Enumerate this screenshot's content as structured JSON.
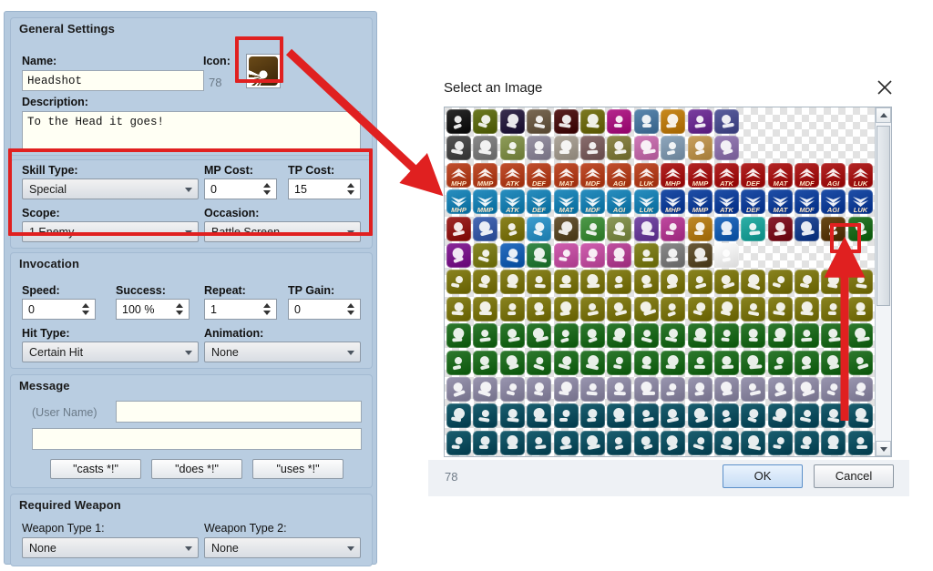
{
  "editor": {
    "general": {
      "title": "General Settings",
      "name_label": "Name:",
      "name_value": "Headshot",
      "icon_label": "Icon:",
      "icon_index": "78",
      "description_label": "Description:",
      "description_value": "To the Head it goes!"
    },
    "skill": {
      "skill_type_label": "Skill Type:",
      "skill_type_value": "Special",
      "mp_cost_label": "MP Cost:",
      "mp_cost_value": "0",
      "tp_cost_label": "TP Cost:",
      "tp_cost_value": "15",
      "scope_label": "Scope:",
      "scope_value": "1 Enemy",
      "occasion_label": "Occasion:",
      "occasion_value": "Battle Screen"
    },
    "invocation": {
      "title": "Invocation",
      "speed_label": "Speed:",
      "speed_value": "0",
      "success_label": "Success:",
      "success_value": "100 %",
      "repeat_label": "Repeat:",
      "repeat_value": "1",
      "tp_gain_label": "TP Gain:",
      "tp_gain_value": "0",
      "hit_type_label": "Hit Type:",
      "hit_type_value": "Certain Hit",
      "animation_label": "Animation:",
      "animation_value": "None"
    },
    "message": {
      "title": "Message",
      "user_name_label": "(User Name)",
      "line1_value": "",
      "line2_value": "",
      "preset_casts": "\"casts *!\"",
      "preset_does": "\"does *!\"",
      "preset_uses": "\"uses *!\""
    },
    "required_weapon": {
      "title": "Required Weapon",
      "weapon1_label": "Weapon Type 1:",
      "weapon1_value": "None",
      "weapon2_label": "Weapon Type 2:",
      "weapon2_value": "None"
    }
  },
  "dialog": {
    "title": "Select an Image",
    "close_icon": "close-icon",
    "status_index": "78",
    "ok_label": "OK",
    "cancel_label": "Cancel",
    "selected_icon_index": 78,
    "grid": {
      "columns": 16,
      "rows": 13,
      "row_themes": [
        {
          "row": 0,
          "filled": 11,
          "colors": [
            "#2b2b2b",
            "#6d7a24",
            "#3a3050",
            "#7a6a55",
            "#5a2020",
            "#7d7a22",
            "#b6288e",
            "#5b87ae",
            "#c98a1e",
            "#7b3fa0",
            "#5b5f9e"
          ]
        },
        {
          "row": 1,
          "filled": 11,
          "colors": [
            "#565656",
            "#8a8a8a",
            "#8f9d5a",
            "#9a95a6",
            "#b0a89c",
            "#8a6e6e",
            "#8f8a4e",
            "#d07bb8",
            "#8fa7bd",
            "#c9a15e",
            "#9a80b8"
          ]
        },
        {
          "row": 2,
          "filled": 16,
          "colors": [
            "#c1502f",
            "#c1502f",
            "#c1502f",
            "#c1502f",
            "#c1502f",
            "#c1502f",
            "#c1502f",
            "#c1502f",
            "#b32626",
            "#b32626",
            "#b32626",
            "#b32626",
            "#b32626",
            "#b32626",
            "#b32626",
            "#b32626"
          ]
        },
        {
          "row": 3,
          "filled": 16,
          "colors": [
            "#2a8fc0",
            "#2a8fc0",
            "#2a8fc0",
            "#2a8fc0",
            "#2a8fc0",
            "#2a8fc0",
            "#2a8fc0",
            "#2a8fc0",
            "#2050a8",
            "#2050a8",
            "#2050a8",
            "#2050a8",
            "#2050a8",
            "#2050a8",
            "#2050a8",
            "#2050a8"
          ]
        },
        {
          "row": 4,
          "filled": 16,
          "colors": [
            "#a02a28",
            "#4a6bb5",
            "#8c8420",
            "#3f9fd0",
            "#6b5a3a",
            "#4f9a4a",
            "#8d9a5a",
            "#7a4fa8",
            "#c04aa0",
            "#c08a2a",
            "#2a6fc0",
            "#2fb0a8",
            "#8a2030",
            "#2a4f9a",
            "#6a4a18",
            "#2e7a2e"
          ]
        },
        {
          "row": 5,
          "filled": 11,
          "colors": [
            "#8a2a9a",
            "#8a8a2a",
            "#2a6fc0",
            "#3a8a4a",
            "#d060b0",
            "#d060b0",
            "#c050a0",
            "#8a8a2a",
            "#8a8a8a",
            "#6a5a3a",
            "#ffffff"
          ]
        },
        {
          "row": 6,
          "filled": 16,
          "colors": [
            "#8a8420",
            "#8a8420",
            "#8a8420",
            "#8a8420",
            "#8a8420",
            "#8a8420",
            "#8a8420",
            "#8a8420",
            "#8a8420",
            "#8a8420",
            "#8a8420",
            "#8a8420",
            "#8a8420",
            "#8a8420",
            "#8a8420",
            "#8a8420"
          ]
        },
        {
          "row": 7,
          "filled": 16,
          "colors": [
            "#8a8420",
            "#8a8420",
            "#8a8420",
            "#8a8420",
            "#8a8420",
            "#8a8420",
            "#8a8420",
            "#8a8420",
            "#8a8420",
            "#8a8420",
            "#8a8420",
            "#8a8420",
            "#8a8420",
            "#8a8420",
            "#8a8420",
            "#8a8420"
          ]
        },
        {
          "row": 8,
          "filled": 16,
          "colors": [
            "#2f7a2f",
            "#2f7a2f",
            "#2f7a2f",
            "#2f7a2f",
            "#2f7a2f",
            "#2f7a2f",
            "#2f7a2f",
            "#2f7a2f",
            "#2f7a2f",
            "#2f7a2f",
            "#2f7a2f",
            "#2f7a2f",
            "#2f7a2f",
            "#2f7a2f",
            "#2f7a2f",
            "#2f7a2f"
          ]
        },
        {
          "row": 9,
          "filled": 16,
          "colors": [
            "#2f7a2f",
            "#2f7a2f",
            "#2f7a2f",
            "#2f7a2f",
            "#2f7a2f",
            "#2f7a2f",
            "#2f7a2f",
            "#2f7a2f",
            "#2f7a2f",
            "#2f7a2f",
            "#2f7a2f",
            "#2f7a2f",
            "#2f7a2f",
            "#2f7a2f",
            "#2f7a2f",
            "#2f7a2f"
          ]
        },
        {
          "row": 10,
          "filled": 16,
          "colors": [
            "#9a96b0",
            "#9a96b0",
            "#9a96b0",
            "#9a96b0",
            "#9a96b0",
            "#9a96b0",
            "#9a96b0",
            "#9a96b0",
            "#9a96b0",
            "#9a96b0",
            "#9a96b0",
            "#9a96b0",
            "#9a96b0",
            "#9a96b0",
            "#9a96b0",
            "#9a96b0"
          ]
        },
        {
          "row": 11,
          "filled": 16,
          "colors": [
            "#1b5f70",
            "#1b5f70",
            "#1b5f70",
            "#1b5f70",
            "#1b5f70",
            "#1b5f70",
            "#1b5f70",
            "#1b5f70",
            "#1b5f70",
            "#1b5f70",
            "#1b5f70",
            "#1b5f70",
            "#1b5f70",
            "#1b5f70",
            "#1b5f70",
            "#1b5f70"
          ]
        },
        {
          "row": 12,
          "filled": 16,
          "colors": [
            "#1b5f70",
            "#1b5f70",
            "#1b5f70",
            "#1b5f70",
            "#1b5f70",
            "#1b5f70",
            "#1b5f70",
            "#1b5f70",
            "#1b5f70",
            "#1b5f70",
            "#1b5f70",
            "#1b5f70",
            "#1b5f70",
            "#1b5f70",
            "#1b5f70",
            "#1b5f70"
          ]
        }
      ],
      "stat_labels_row2": [
        "MHP",
        "MMP",
        "ATK",
        "DEF",
        "MAT",
        "MDF",
        "AGI",
        "LUK",
        "MHP",
        "MMP",
        "ATK",
        "DEF",
        "MAT",
        "MDF",
        "AGI",
        "LUK"
      ],
      "stat_labels_row3": [
        "MHP",
        "MMP",
        "ATK",
        "DEF",
        "MAT",
        "MDF",
        "AGI",
        "LUK",
        "MHP",
        "MMP",
        "ATK",
        "DEF",
        "MAT",
        "MDF",
        "AGI",
        "LUK"
      ]
    }
  },
  "annotations": {
    "accent_color": "#e02020",
    "arrow_diagonal": "icon-to-dialog-arrow",
    "arrow_vertical": "grid-selection-arrow",
    "box_icon": "icon-preview-highlight",
    "box_skill": "skill-type-section-highlight",
    "box_grid_selection": "selected-icon-highlight"
  }
}
